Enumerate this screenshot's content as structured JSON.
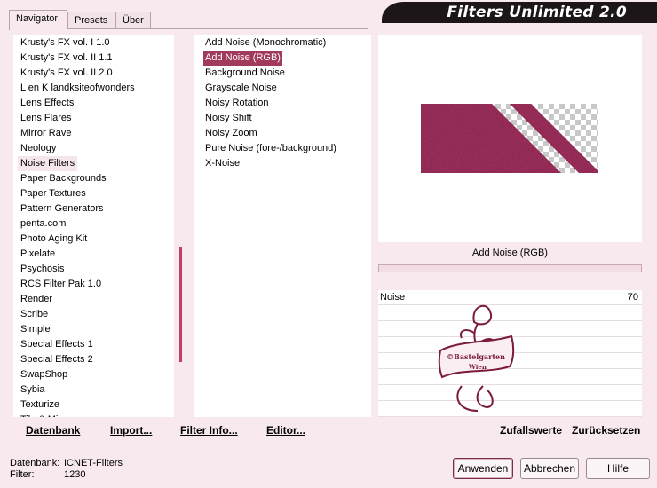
{
  "tabs": [
    "Navigator",
    "Presets",
    "Über"
  ],
  "banner_title": "Filters Unlimited 2.0",
  "categories": [
    "Krusty's FX vol. I 1.0",
    "Krusty's FX vol. II 1.1",
    "Krusty's FX vol. II 2.0",
    "L en K landksiteofwonders",
    "Lens Effects",
    "Lens Flares",
    "Mirror Rave",
    "Neology",
    "Noise Filters",
    "Paper Backgrounds",
    "Paper Textures",
    "Pattern Generators",
    "penta.com",
    "Photo Aging Kit",
    "Pixelate",
    "Psychosis",
    "RCS Filter Pak 1.0",
    "Render",
    "Scribe",
    "Simple",
    "Special Effects 1",
    "Special Effects 2",
    "SwapShop",
    "Sybia",
    "Texturize",
    "Tile & Mirror"
  ],
  "selected_category": "Noise Filters",
  "filters": [
    "Add Noise (Monochromatic)",
    "Add Noise (RGB)",
    "Background Noise",
    "Grayscale Noise",
    "Noisy Rotation",
    "Noisy Shift",
    "Noisy Zoom",
    "Pure Noise (fore-/background)",
    "X-Noise"
  ],
  "selected_filter": "Add Noise (RGB)",
  "filter_name": "Add Noise (RGB)",
  "params": [
    {
      "name": "Noise",
      "value": "70"
    }
  ],
  "watermark": {
    "line1": "©Bastelgarten",
    "line2": "Wien"
  },
  "toolbar": {
    "datenbank": "Datenbank",
    "import": "Import...",
    "filter_info": "Filter Info...",
    "editor": "Editor...",
    "zufallswerte": "Zufallswerte",
    "zuruecksetzen": "Zurücksetzen"
  },
  "status": {
    "db_label": "Datenbank:",
    "db_value": "ICNET-Filters",
    "filter_label": "Filter:",
    "filter_value": "1230"
  },
  "buttons": {
    "apply": "Anwenden",
    "cancel": "Abbrechen",
    "help": "Hilfe"
  },
  "colors": {
    "accent": "#a23a5b",
    "background": "#f7e9ee",
    "banner": "#1c1618"
  }
}
